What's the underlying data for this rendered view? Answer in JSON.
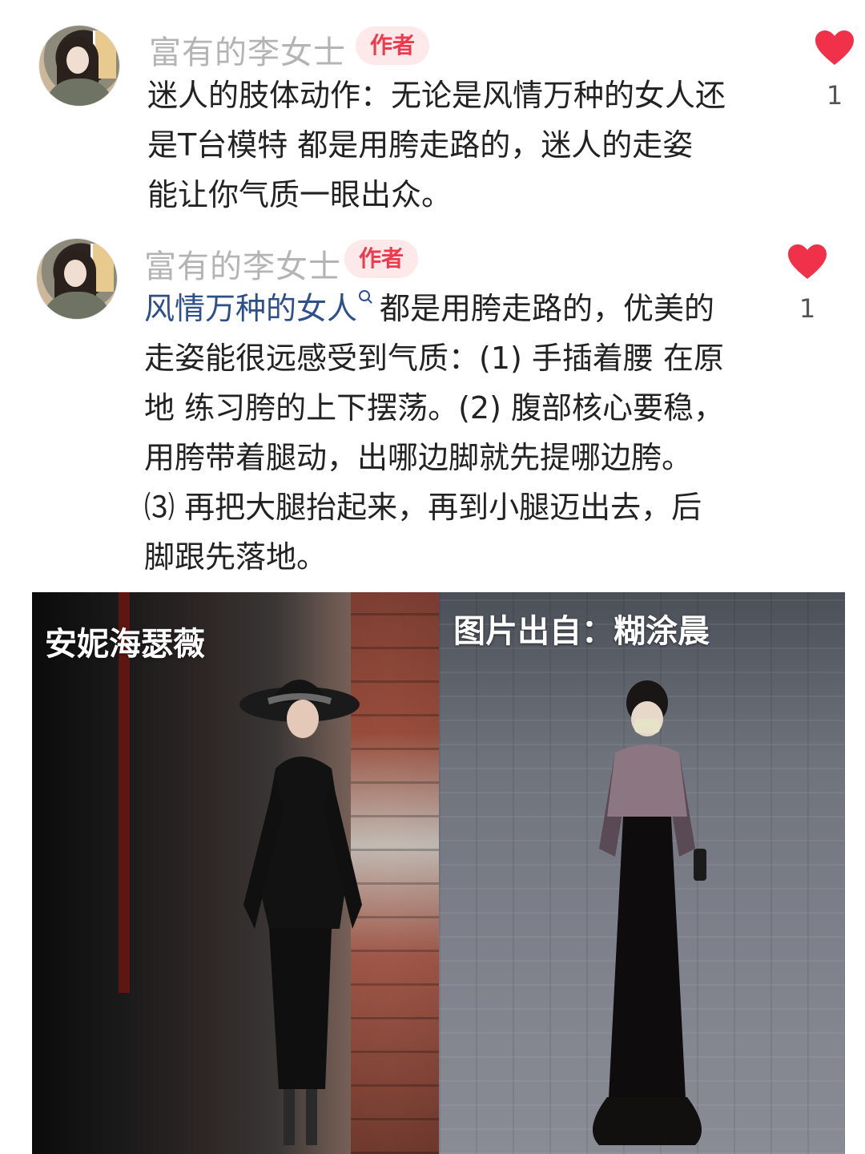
{
  "comments": [
    {
      "username": "富有的李女士",
      "badge": "作者",
      "lines": [
        "迷人的肢体动作：无论是风情万种的女人还",
        "是T台模特 都是用胯走路的，迷人的走姿",
        "能让你气质一眼出众。"
      ],
      "likes": "1"
    },
    {
      "username": "富有的李女士",
      "badge": "作者",
      "link_text": "风情万种的女人",
      "first_line_rest": "都是用胯走路的，优美的",
      "lines": [
        "走姿能很远感受到气质：(1) 手插着腰 在原",
        "地 练习胯的上下摆荡。(2) 腹部核心要稳，",
        "用胯带着腿动，出哪边脚就先提哪边胯。",
        "⑶ 再把大腿抬起来，再到小腿迈出去，后",
        "脚跟先落地。"
      ],
      "likes": "1"
    }
  ],
  "photos": {
    "left_caption": "安妮海瑟薇",
    "right_caption": "图片出自：糊涂晨"
  },
  "colors": {
    "like_red": "#f1304a",
    "badge_bg": "#fde8ea",
    "badge_text": "#ee3a4d",
    "username": "#b4b4b4",
    "link": "#2d4f8a"
  },
  "icons": {
    "like": "heart-icon",
    "search": "search-icon"
  }
}
